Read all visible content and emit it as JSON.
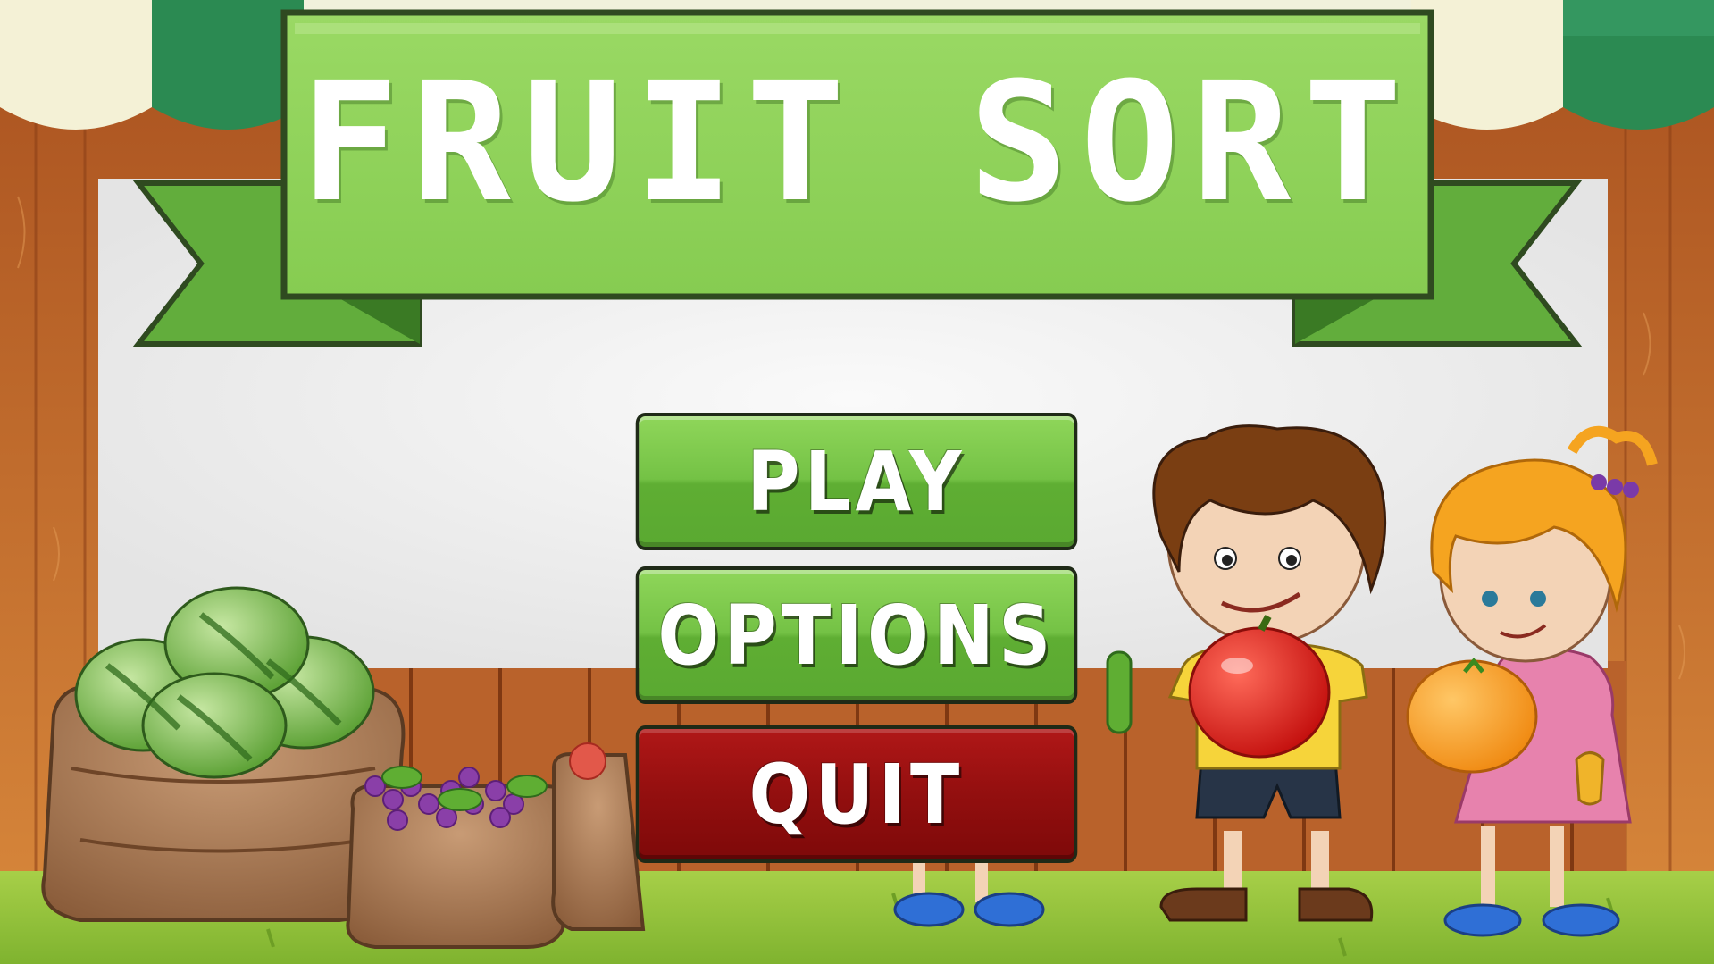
{
  "game": {
    "title": "FRUIT SORT"
  },
  "menu": {
    "play_label": "PLAY",
    "options_label": "OPTIONS",
    "quit_label": "QUIT"
  },
  "colors": {
    "banner_green": "#8fd65a",
    "banner_dark_green": "#4c9a2d",
    "button_green": "#74c245",
    "button_red": "#930f0f",
    "wood": "#c9712e",
    "grass": "#8fc23a"
  },
  "scene": {
    "icons": [
      "watermelon-sack-icon",
      "grape-sack-icon",
      "boy-with-apple-icon",
      "girl-with-orange-icon",
      "hidden-child-icon"
    ]
  }
}
